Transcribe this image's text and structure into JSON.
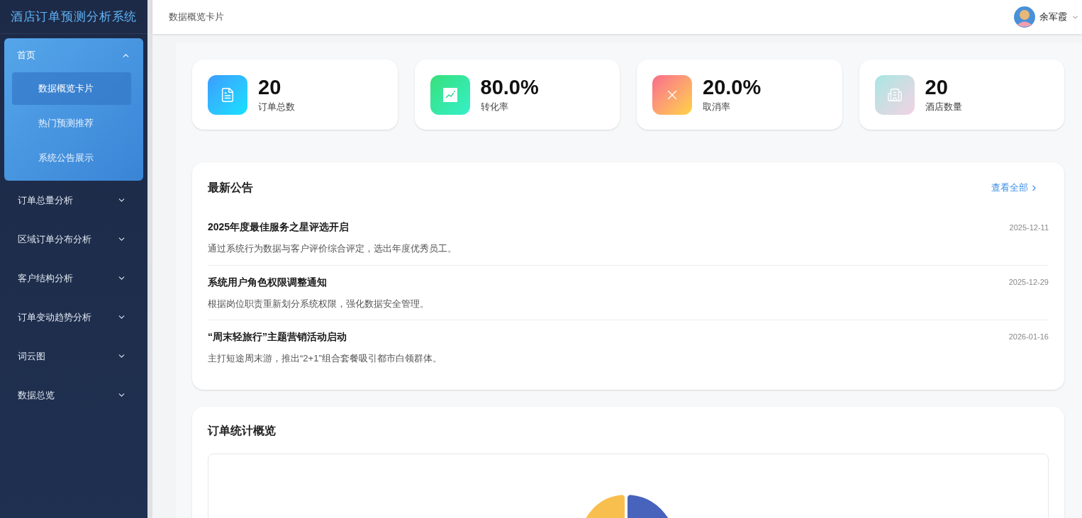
{
  "sidebar": {
    "title": "酒店订单预测分析系统",
    "menu": [
      {
        "label": "首页",
        "expanded": true,
        "children": [
          {
            "label": "数据概览卡片",
            "selected": true
          },
          {
            "label": "热门预测推荐",
            "selected": false
          },
          {
            "label": "系统公告展示",
            "selected": false
          }
        ]
      },
      {
        "label": "订单总量分析",
        "expanded": false
      },
      {
        "label": "区域订单分布分析",
        "expanded": false
      },
      {
        "label": "客户结构分析",
        "expanded": false
      },
      {
        "label": "订单变动趋势分析",
        "expanded": false
      },
      {
        "label": "词云图",
        "expanded": false
      },
      {
        "label": "数据总览",
        "expanded": false
      }
    ]
  },
  "header": {
    "breadcrumb": "数据概览卡片",
    "user": "余军霞"
  },
  "stats": [
    {
      "kind": "document",
      "value": "20",
      "label": "订单总数"
    },
    {
      "kind": "trend",
      "value": "80.0%",
      "label": "转化率"
    },
    {
      "kind": "cancel",
      "value": "20.0%",
      "label": "取消率"
    },
    {
      "kind": "building",
      "value": "20",
      "label": "酒店数量"
    }
  ],
  "notices": {
    "title": "最新公告",
    "view_all": "查看全部",
    "items": [
      {
        "title": "2025年度最佳服务之星评选开启",
        "desc": "通过系统行为数据与客户评价综合评定，选出年度优秀员工。",
        "date": "2025-12-11"
      },
      {
        "title": "系统用户角色权限调整通知",
        "desc": "根据岗位职责重新划分系统权限，强化数据安全管理。",
        "date": "2025-12-29"
      },
      {
        "title": "“周末轻旅行”主题营销活动启动",
        "desc": "主打短途周末游，推出“2+1”组合套餐吸引都市白领群体。",
        "date": "2026-01-16"
      }
    ]
  },
  "order_stats": {
    "title": "订单统计概览"
  }
}
